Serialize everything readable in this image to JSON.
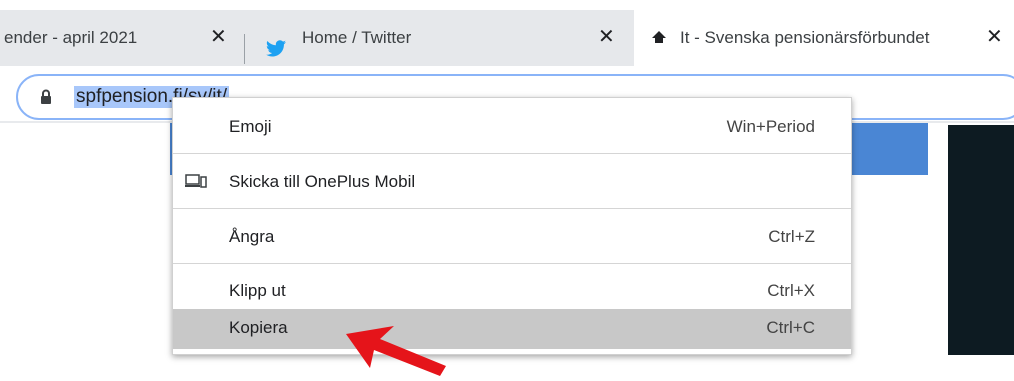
{
  "tabs": [
    {
      "title": "ender - april 2021",
      "close": "✕"
    },
    {
      "title": "Home / Twitter",
      "close": "✕",
      "icon": "twitter-icon"
    },
    {
      "title": "It - Svenska pensionärsförbundet",
      "close": "✕",
      "icon": "home-icon"
    }
  ],
  "omnibox": {
    "url": "spfpension.fi/sv/it/",
    "icon": "lock-icon"
  },
  "context_menu": {
    "items": [
      {
        "label": "Emoji",
        "shortcut": "Win+Period"
      },
      {
        "label": "Skicka till OnePlus Mobil",
        "shortcut": "",
        "icon": "device-icon"
      },
      {
        "label": "Ångra",
        "shortcut": "Ctrl+Z"
      },
      {
        "label": "Klipp ut",
        "shortcut": "Ctrl+X"
      },
      {
        "label": "Kopiera",
        "shortcut": "Ctrl+C",
        "highlighted": true
      }
    ]
  },
  "colors": {
    "accent_blue": "#4a86d4",
    "url_highlight": "#a8c7fa",
    "arrow_red": "#e5141a",
    "twitter_blue": "#1da1f2"
  }
}
